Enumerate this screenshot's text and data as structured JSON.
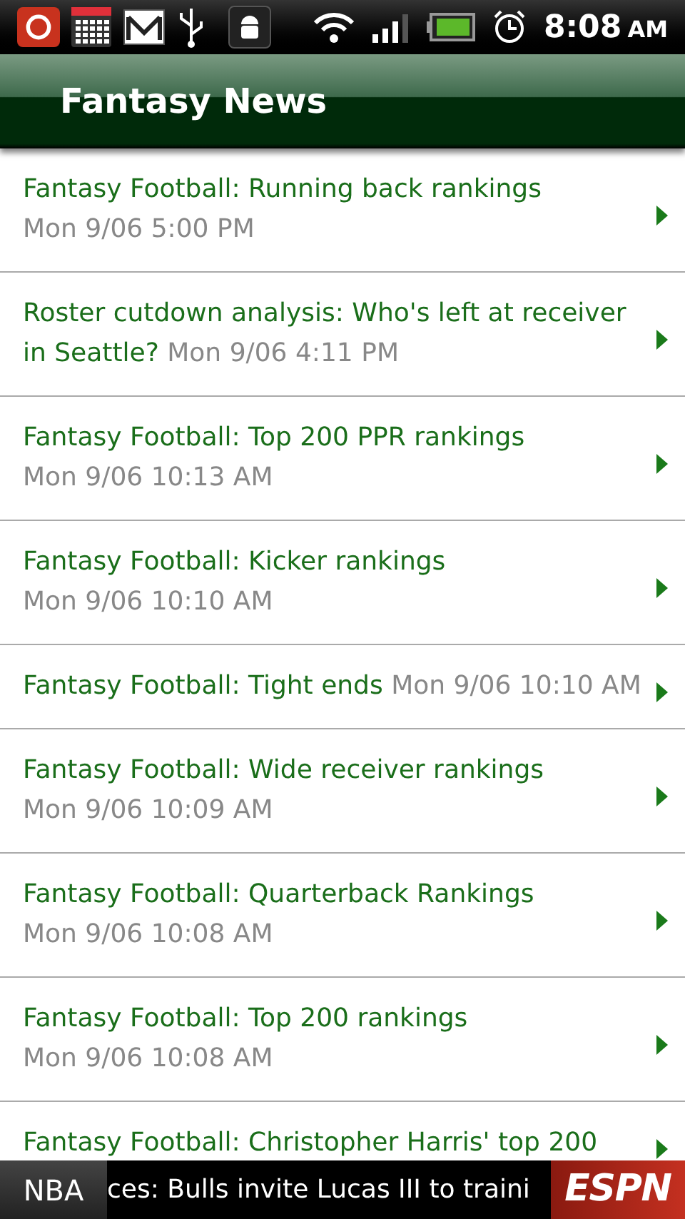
{
  "status_bar": {
    "time": "8:08",
    "ampm": "AM"
  },
  "header": {
    "title": "Fantasy News"
  },
  "articles": [
    {
      "title": "Fantasy Football: Running back rankings",
      "time": "Mon 9/06 5:00 PM",
      "kind": "stacked"
    },
    {
      "title": "Roster cutdown analysis: Who's left at receiver in Seattle?",
      "time": "Mon 9/06 4:11 PM",
      "kind": "inline"
    },
    {
      "title": "Fantasy Football: Top 200 PPR rankings",
      "time": "Mon 9/06 10:13 AM",
      "kind": "stacked"
    },
    {
      "title": "Fantasy Football: Kicker rankings",
      "time": "Mon 9/06 10:10 AM",
      "kind": "stacked"
    },
    {
      "title": "Fantasy Football: Tight ends",
      "time": "Mon 9/06 10:10 AM",
      "kind": "inline"
    },
    {
      "title": "Fantasy Football: Wide receiver rankings",
      "time": "Mon 9/06 10:09 AM",
      "kind": "stacked"
    },
    {
      "title": "Fantasy Football: Quarterback Rankings",
      "time": "Mon 9/06 10:08 AM",
      "kind": "stacked"
    },
    {
      "title": "Fantasy Football: Top 200 rankings",
      "time": "Mon 9/06 10:08 AM",
      "kind": "stacked"
    },
    {
      "title": "Fantasy Football: Christopher Harris' top 200",
      "kind": "stacked"
    }
  ],
  "ticker": {
    "league": "NBA",
    "headline": "ces: Bulls invite Lucas III to traini",
    "logo": "ESPN"
  }
}
